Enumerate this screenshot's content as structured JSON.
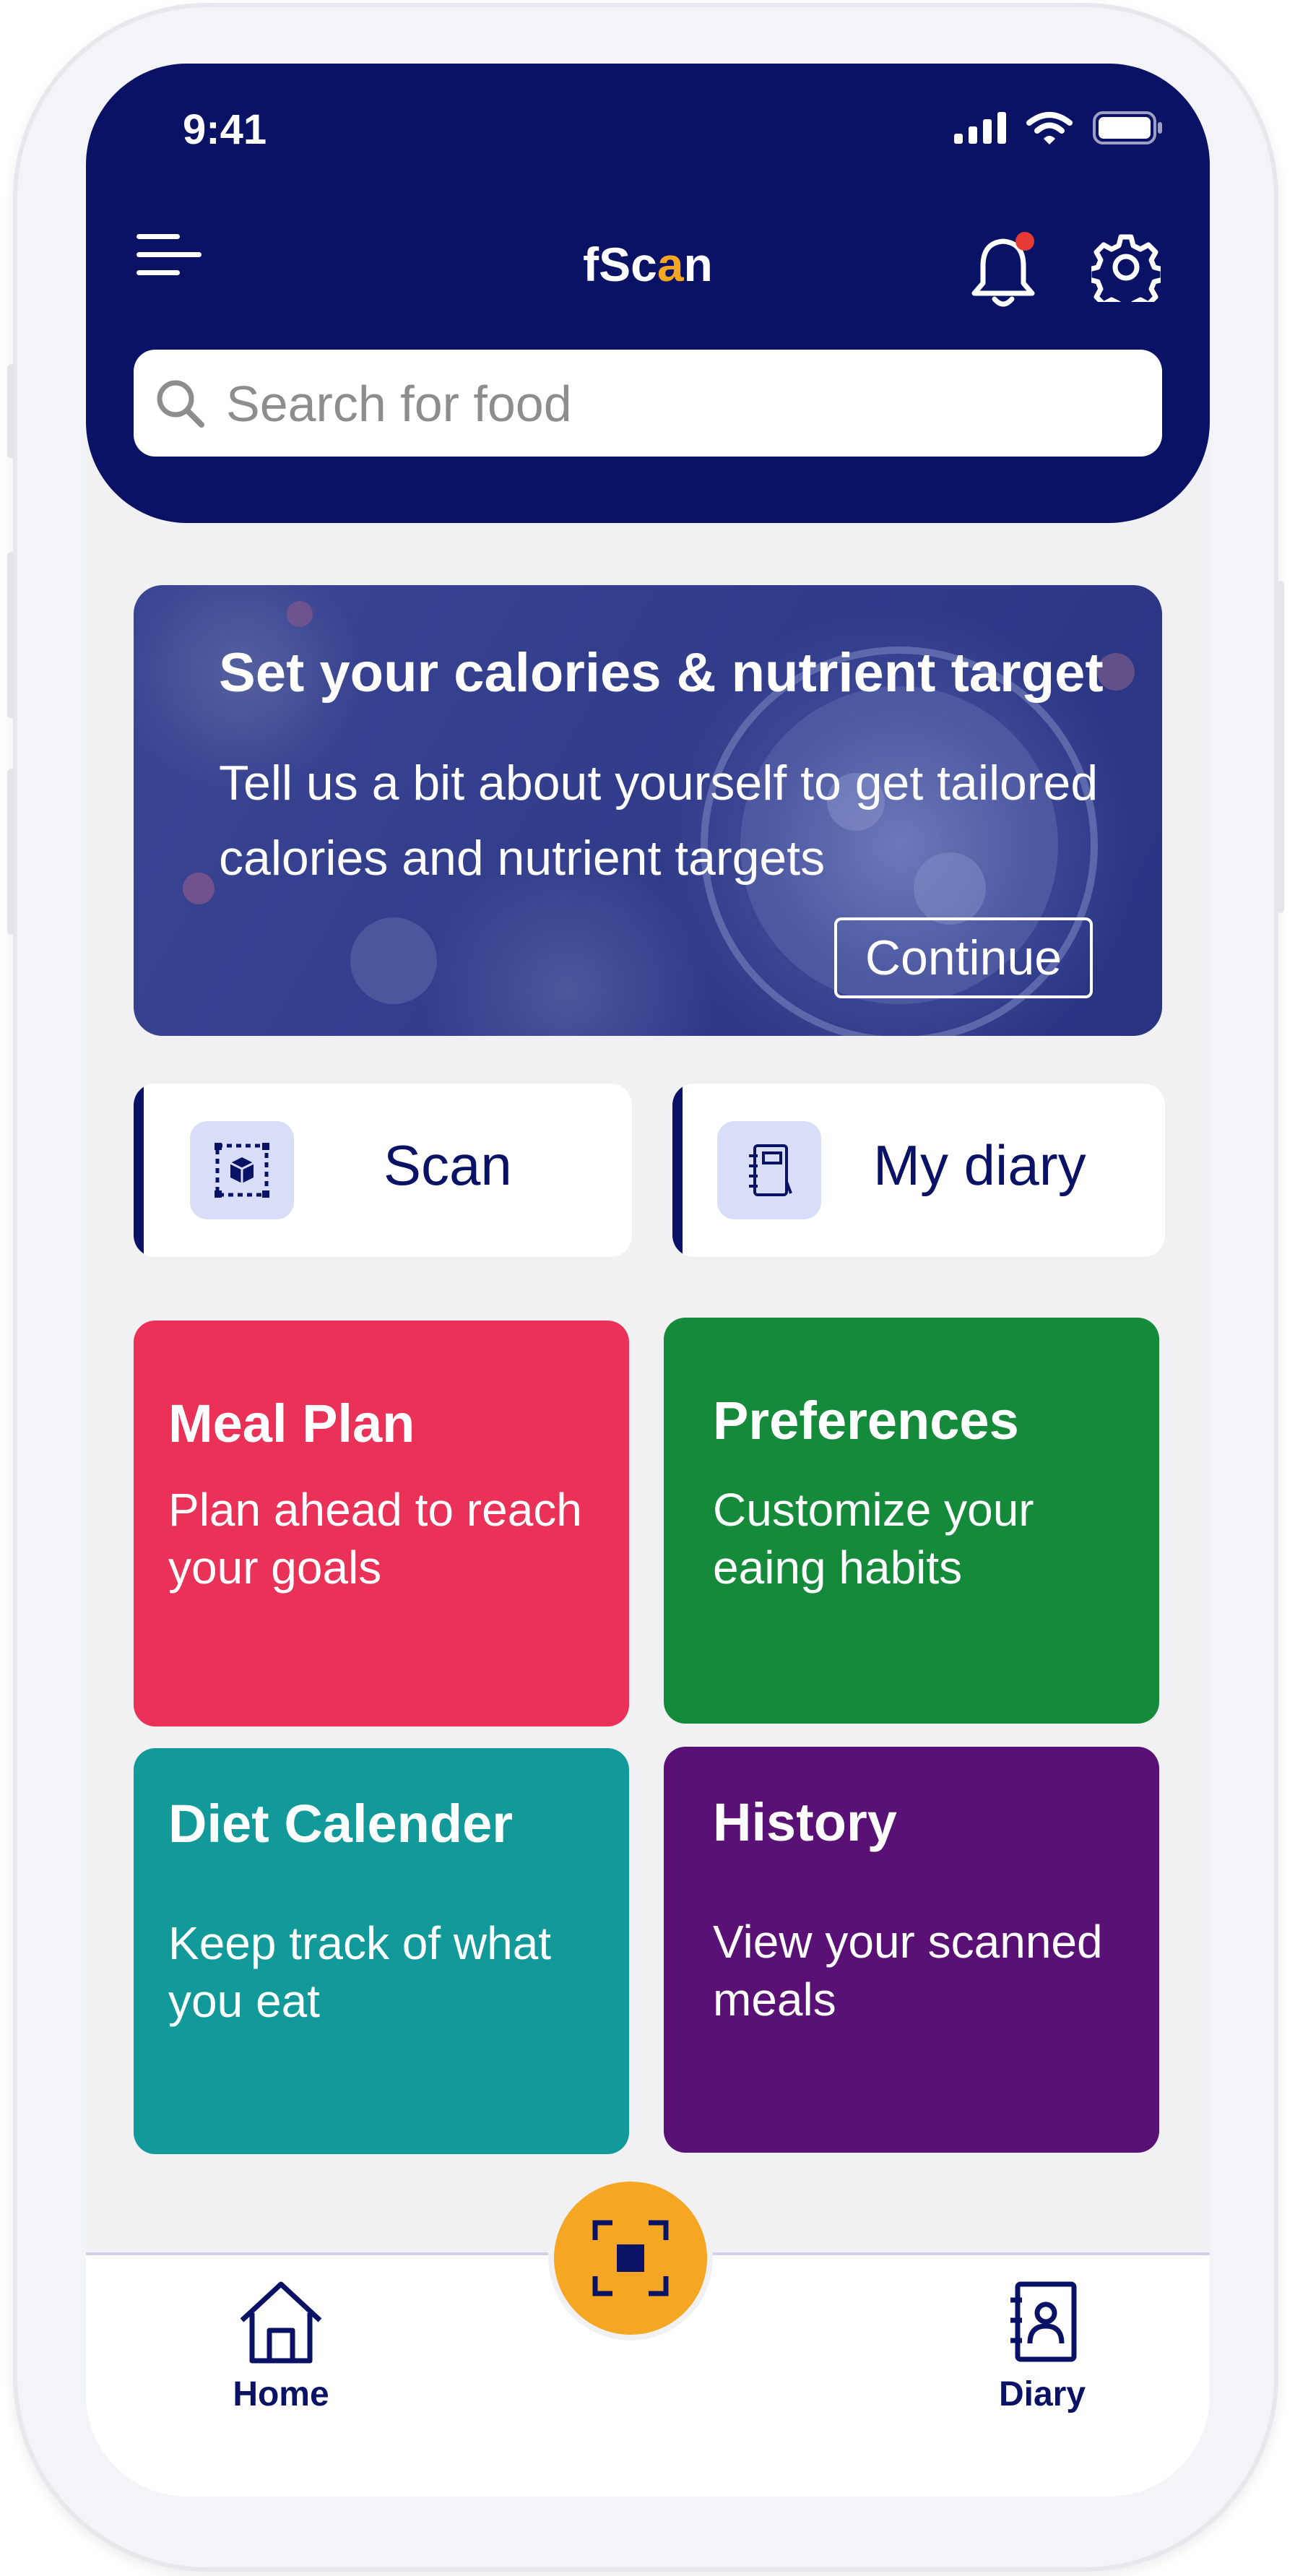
{
  "status_bar": {
    "time": "9:41"
  },
  "header": {
    "title_prefix": "fSc",
    "title_accent": "a",
    "title_suffix": "n",
    "search_placeholder": "Search for food"
  },
  "banner": {
    "title": "Set your calories &  nutrient target",
    "text": "Tell us a bit about yourself to get tailored calories and nutrient targets",
    "button": "Continue"
  },
  "quick_actions": [
    {
      "label": "Scan",
      "icon": "scan-cube-icon"
    },
    {
      "label": "My diary",
      "icon": "notebook-icon"
    }
  ],
  "tiles": [
    {
      "title": "Meal Plan",
      "subtitle": "Plan ahead to reach your goals",
      "color": "#ea3157"
    },
    {
      "title": "Preferences",
      "subtitle": "Customize your eaing habits",
      "color": "#148a3a"
    },
    {
      "title": "Diet Calender",
      "subtitle": "Keep track of what you eat",
      "color": "#119a99"
    },
    {
      "title": "History",
      "subtitle": "View your scanned meals",
      "color": "#591176"
    }
  ],
  "bottom_nav": [
    {
      "label": "Home",
      "icon": "home-icon"
    },
    {
      "label": "Diary",
      "icon": "contact-book-icon"
    }
  ],
  "colors": {
    "primary": "#0a1266",
    "accent": "#f5a623",
    "notification_dot": "#e53935"
  }
}
